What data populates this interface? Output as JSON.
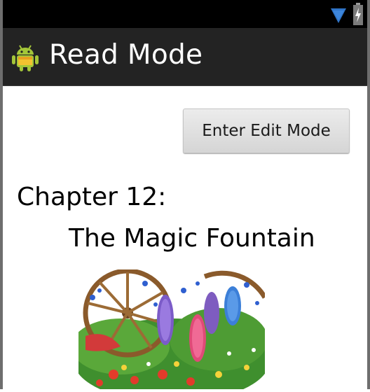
{
  "status_bar": {
    "icons": [
      "wifi-icon",
      "battery-charging-icon"
    ]
  },
  "action_bar": {
    "icon": "android-icon",
    "title": "Read Mode"
  },
  "content": {
    "edit_button_label": "Enter Edit Mode",
    "chapter_number": "Chapter 12:",
    "chapter_title": "The Magic Fountain",
    "illustration": "garden-illustration"
  },
  "colors": {
    "status_bar": "#000000",
    "action_bar": "#232323",
    "android_green": "#a4c639",
    "wifi_blue": "#2f74c8"
  }
}
